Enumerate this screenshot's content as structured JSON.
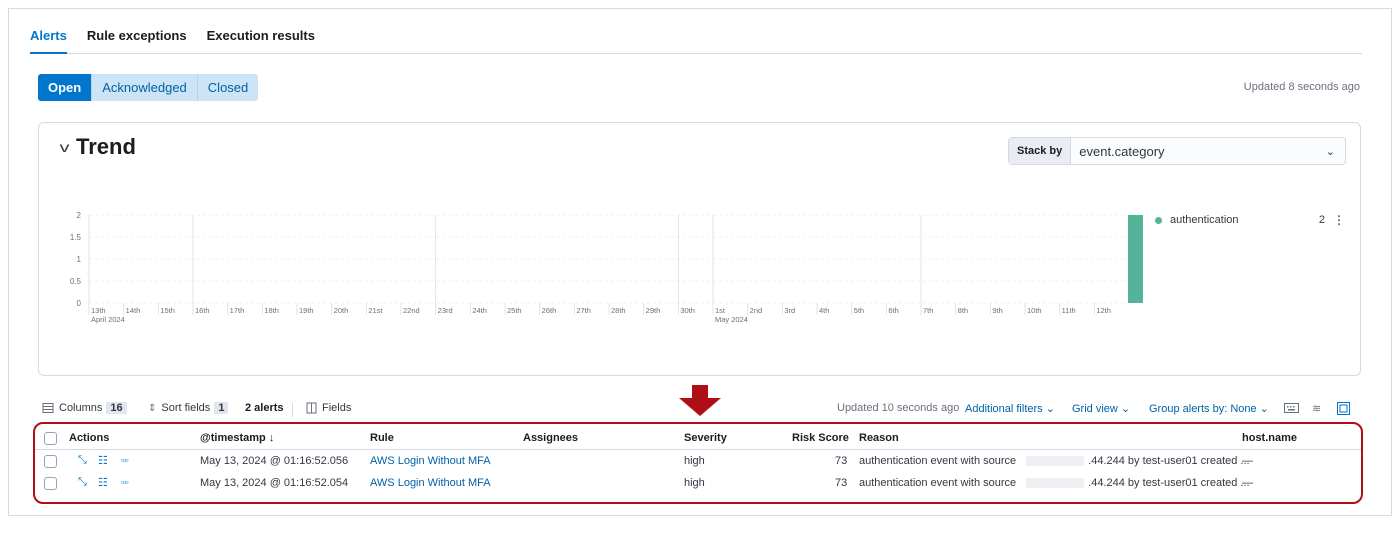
{
  "tabs": [
    {
      "label": "Alerts",
      "active": true
    },
    {
      "label": "Rule exceptions",
      "active": false
    },
    {
      "label": "Execution results",
      "active": false
    }
  ],
  "status_filter": {
    "options": [
      "Open",
      "Acknowledged",
      "Closed"
    ],
    "selected": "Open"
  },
  "updated_top": "Updated 8 seconds ago",
  "trend": {
    "title": "Trend",
    "stack_by_label": "Stack by",
    "stack_by_value": "event.category"
  },
  "chart_data": {
    "type": "bar",
    "y_ticks": [
      "2",
      "1.5",
      "1",
      "0.5",
      "0"
    ],
    "ylim": [
      0,
      2
    ],
    "x_ticks": [
      "13th",
      "14th",
      "15th",
      "16th",
      "17th",
      "18th",
      "19th",
      "20th",
      "21st",
      "22nd",
      "23rd",
      "24th",
      "25th",
      "26th",
      "27th",
      "28th",
      "29th",
      "30th",
      "1st",
      "2nd",
      "3rd",
      "4th",
      "5th",
      "6th",
      "7th",
      "8th",
      "9th",
      "10th",
      "11th",
      "12th"
    ],
    "month_labels": [
      {
        "label": "April 2024",
        "at": "13th"
      },
      {
        "label": "May 2024",
        "at": "1st"
      }
    ],
    "series": [
      {
        "name": "authentication",
        "color": "#54b399",
        "x": "2024-05-13",
        "value": 2
      }
    ],
    "legend": {
      "name": "authentication",
      "count": "2"
    },
    "legend_position": "right"
  },
  "toolbar": {
    "columns_label": "Columns",
    "columns_count": "16",
    "sort_label": "Sort fields",
    "sort_count": "1",
    "alerts_count": "2 alerts",
    "fields_label": "Fields",
    "updated": "Updated 10 seconds ago",
    "additional_filters": "Additional filters",
    "grid_view": "Grid view",
    "group_by": "Group alerts by: None"
  },
  "table": {
    "headers": {
      "actions": "Actions",
      "timestamp": "@timestamp",
      "rule": "Rule",
      "assignees": "Assignees",
      "severity": "Severity",
      "risk_score": "Risk Score",
      "reason": "Reason",
      "host_name": "host.name"
    },
    "rows": [
      {
        "timestamp": "May 13, 2024 @ 01:16:52.056",
        "rule": "AWS Login Without MFA",
        "severity": "high",
        "risk_score": "73",
        "reason_start": "authentication event with source",
        "reason_end": ".44.244 by test-user01 created ...",
        "host_name": "—"
      },
      {
        "timestamp": "May 13, 2024 @ 01:16:52.054",
        "rule": "AWS Login Without MFA",
        "severity": "high",
        "risk_score": "73",
        "reason_start": "authentication event with source",
        "reason_end": ".44.244 by test-user01 created ...",
        "host_name": "—"
      }
    ]
  }
}
